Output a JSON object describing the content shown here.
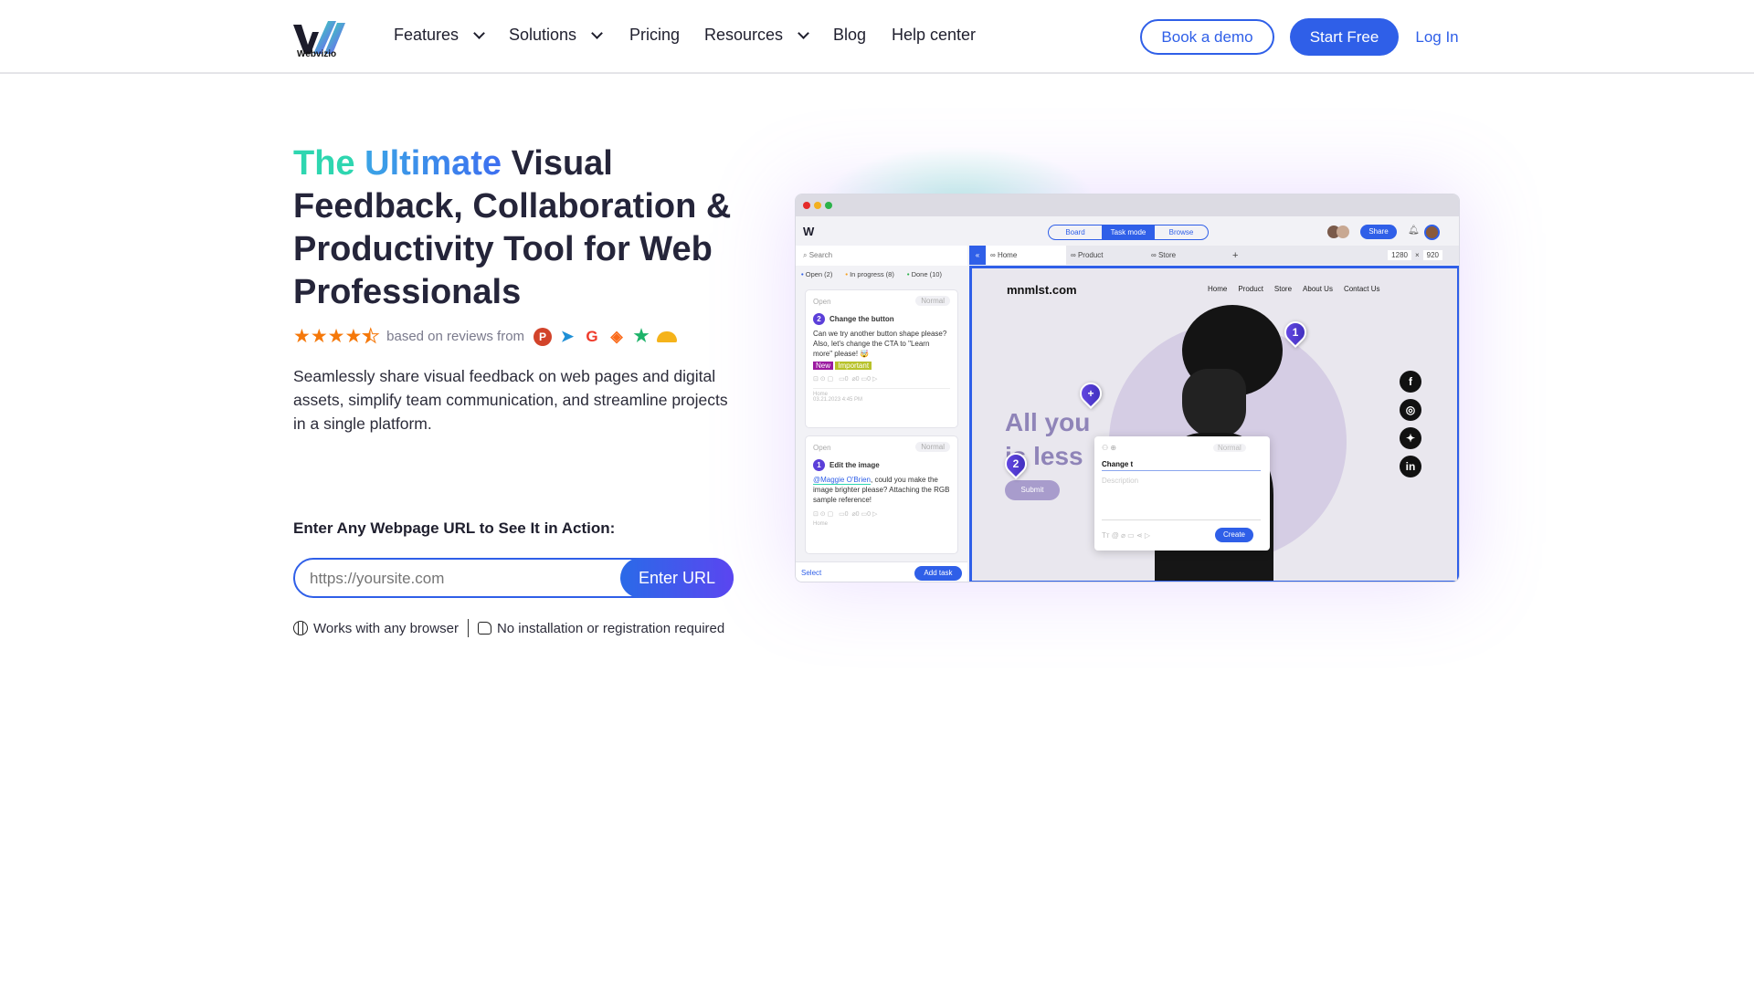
{
  "brand": {
    "name": "Webvizio"
  },
  "nav": {
    "items": [
      {
        "label": "Features",
        "dropdown": true
      },
      {
        "label": "Solutions",
        "dropdown": true
      },
      {
        "label": "Pricing"
      },
      {
        "label": "Resources",
        "dropdown": true
      },
      {
        "label": "Blog"
      },
      {
        "label": "Help center"
      }
    ],
    "book_demo": "Book a demo",
    "start_free": "Start Free",
    "login": "Log In"
  },
  "hero": {
    "title_a": "The",
    "title_b": "Ultimate",
    "title_rest": "Visual Feedback, Collaboration & Productivity Tool for Web Professionals",
    "rating": 4.5,
    "reviews_text": "based on reviews from",
    "review_sources": [
      "producthunt-icon",
      "capterra-icon",
      "g2-icon",
      "getapp-icon",
      "trustpilot-icon",
      "crozdesk-icon"
    ],
    "description": "Seamlessly share visual feedback on web pages and digital assets, simplify team communication, and streamline projects in a single platform.",
    "cta_heading": "Enter Any Webpage URL to See It in Action:",
    "url_placeholder": "https://yoursite.com",
    "url_value": "",
    "enter_url": "Enter URL",
    "note1": "Works with any browser",
    "note2": "No installation or registration required"
  },
  "mockup": {
    "modes": [
      "Board",
      "Task mode",
      "Browse"
    ],
    "active_mode": "Task mode",
    "share": "Share",
    "search": "Search",
    "filters": [
      "Open (2)",
      "In progress (8)",
      "Done (10)"
    ],
    "tabs": [
      "Home",
      "Product",
      "Store"
    ],
    "width": "1280",
    "height": "920",
    "tasks": [
      {
        "status": "Open",
        "priority": "Normal",
        "num": "2",
        "title": "Change the button",
        "body": "Can we try another button shape please? Also, let's change the CTA to \"Learn more\" please! 🤯",
        "tags": [
          "New",
          "Important"
        ],
        "page": "Home",
        "date": "03.21.2023 4:45 PM"
      },
      {
        "status": "Open",
        "priority": "Normal",
        "num": "1",
        "title": "Edit the image",
        "mention": "@Maggie O'Brien",
        "body": ", could you make the image brighter please? Attaching the RGB sample reference!",
        "page": "Home"
      }
    ],
    "select": "Select",
    "add_task": "Add task",
    "site": {
      "logo": "mnmlst.com",
      "nav": [
        "Home",
        "Product",
        "Store",
        "About Us",
        "Contact Us"
      ],
      "headline1": "All you",
      "headline2": "is less",
      "submit": "Submit"
    },
    "pins": [
      "1",
      "2",
      "+"
    ],
    "popup": {
      "title_value": "Change t",
      "desc_placeholder": "Description",
      "priority": "Normal",
      "create": "Create"
    }
  },
  "colors": {
    "primary": "#2f5fe8",
    "teal": "#2ed6b0",
    "purple": "#5b3fd9"
  }
}
